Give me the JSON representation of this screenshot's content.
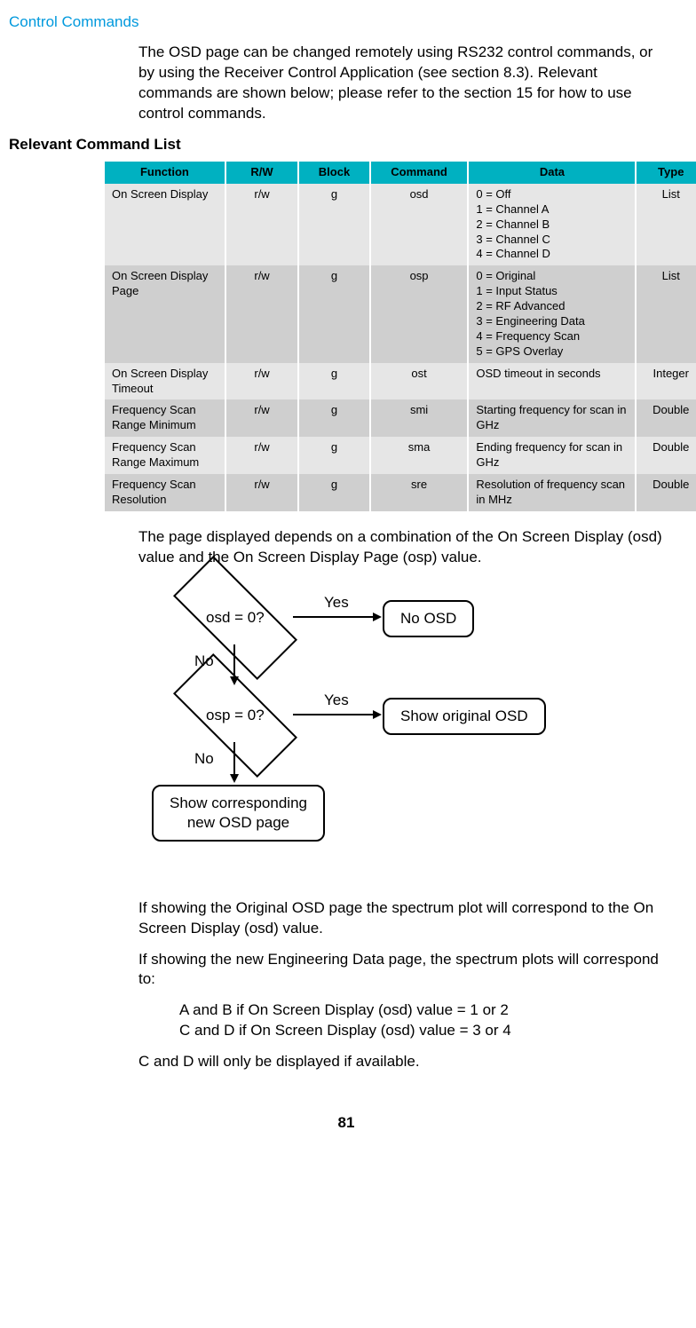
{
  "section_title": "Control Commands",
  "intro_paragraph": "The OSD page can be changed remotely using RS232 control commands, or by using the Receiver Control Application (see section 8.3). Relevant commands are shown below; please refer to the section 15 for how to use control commands.",
  "table_heading": "Relevant Command List",
  "table": {
    "headers": [
      "Function",
      "R/W",
      "Block",
      "Command",
      "Data",
      "Type"
    ],
    "rows": [
      {
        "func": "On Screen Display",
        "rw": "r/w",
        "block": "g",
        "cmd": "osd",
        "data": "0 = Off\n1 = Channel A\n2 = Channel B\n3 = Channel C\n4 = Channel D",
        "type": "List",
        "shade": "odd"
      },
      {
        "func": "On Screen Display Page",
        "rw": "r/w",
        "block": "g",
        "cmd": "osp",
        "data": "0 = Original\n1 = Input Status\n2 = RF Advanced\n3 = Engineering Data\n4 = Frequency Scan\n5 = GPS Overlay",
        "type": "List",
        "shade": "even"
      },
      {
        "func": "On Screen Display Timeout",
        "rw": "r/w",
        "block": "g",
        "cmd": "ost",
        "data": "OSD timeout in seconds",
        "type": "Integer",
        "shade": "odd"
      },
      {
        "func": "Frequency Scan Range Minimum",
        "rw": "r/w",
        "block": "g",
        "cmd": "smi",
        "data": "Starting frequency for scan in GHz",
        "type": "Double",
        "shade": "even"
      },
      {
        "func": "Frequency Scan Range Maximum",
        "rw": "r/w",
        "block": "g",
        "cmd": "sma",
        "data": "Ending frequency for scan in GHz",
        "type": "Double",
        "shade": "odd"
      },
      {
        "func": "Frequency Scan Resolution",
        "rw": "r/w",
        "block": "g",
        "cmd": "sre",
        "data": "Resolution of frequency scan in MHz",
        "type": "Double",
        "shade": "even"
      }
    ]
  },
  "post_table_paragraph": "The page displayed depends on a combination of the On Screen Display (osd) value and the On Screen Display Page (osp) value.",
  "flowchart": {
    "d1": "osd = 0?",
    "d2": "osp = 0?",
    "yes": "Yes",
    "no": "No",
    "box_no_osd": "No OSD",
    "box_original": "Show original OSD",
    "box_new": "Show corresponding\nnew OSD page"
  },
  "p_after_flow_1": "If showing the Original OSD page the spectrum plot will correspond to the On Screen Display (osd) value.",
  "p_after_flow_2": "If showing the new Engineering Data page, the spectrum plots will correspond to:",
  "ab_line": "A and B if On Screen Display (osd) value = 1 or 2",
  "cd_line": "C and D if On Screen Display (osd) value = 3 or 4",
  "p_cd_avail": "C and D will only be displayed if available.",
  "page_number": "81"
}
